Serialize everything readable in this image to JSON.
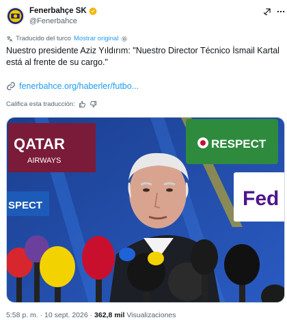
{
  "post": {
    "author_name": "Fenerbahçe SK",
    "author_handle": "@Fenerbahce",
    "verified_color": "#f4b400",
    "translated_label": "Traducido del turco",
    "show_original_label": "Mostrar original",
    "text": "Nuestro presidente Aziz Yıldırım: \"Nuestro Director Técnico İsmail Kartal está al frente de su cargo.\"",
    "link_text": "fenerbahce.org/haberler/futbo...",
    "rate_translation_label": "Califica esta traducción:",
    "time": "5:58 p. m.",
    "separator": "·",
    "date": "10 sept. 2026",
    "views_count": "362,8 mil",
    "views_label": "Visualizaciones"
  },
  "media": {
    "banner_left_top": "QATAR",
    "banner_left_bottom": "AIRWAYS",
    "banner_right": "RESPECT",
    "banner_mid": "SPECT",
    "banner_far_right": "Fed"
  },
  "colors": {
    "link": "#1d9bf0",
    "secondary_text": "#536471",
    "primary_text": "#0f1419",
    "background_blue": "#1f4a9e",
    "qatar_maroon": "#7a1b3a",
    "respect_green": "#2e8b3e"
  },
  "icons": {
    "header": [
      "grok-icon",
      "more-options-icon"
    ],
    "translate": "translate-icon",
    "settings": "gear-icon",
    "link": "link-icon",
    "rating": [
      "thumbs-up-icon",
      "thumbs-down-icon"
    ]
  }
}
